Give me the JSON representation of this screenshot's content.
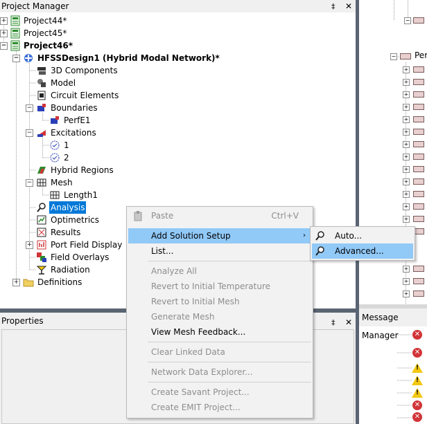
{
  "project_manager": {
    "title": "Project Manager",
    "pin": "‡",
    "close": "✕",
    "tree": [
      {
        "label": "Project44*",
        "bold": false
      },
      {
        "label": "Project45*",
        "bold": false
      },
      {
        "label": "Project46*",
        "bold": true
      },
      {
        "label": "HFSSDesign1 (Hybrid Modal Network)*",
        "bold": true
      },
      {
        "label": "3D Components"
      },
      {
        "label": "Model"
      },
      {
        "label": "Circuit Elements"
      },
      {
        "label": "Boundaries"
      },
      {
        "label": "PerfE1"
      },
      {
        "label": "Excitations"
      },
      {
        "label": "1"
      },
      {
        "label": "2"
      },
      {
        "label": "Hybrid Regions"
      },
      {
        "label": "Mesh"
      },
      {
        "label": "Length1"
      },
      {
        "label": "Analysis"
      },
      {
        "label": "Optimetrics"
      },
      {
        "label": "Results"
      },
      {
        "label": "Port Field Display"
      },
      {
        "label": "Field Overlays"
      },
      {
        "label": "Radiation"
      },
      {
        "label": "Definitions"
      }
    ]
  },
  "properties": {
    "title": "Properties",
    "pin": "‡",
    "close": "✕"
  },
  "message_manager": {
    "title": "Message Manager"
  },
  "right_tree": {
    "visible_label": "Per"
  },
  "context_menu": {
    "items": [
      {
        "label": "Paste",
        "shortcut": "Ctrl+V",
        "disabled": true
      },
      {
        "label": "Add Solution Setup",
        "submenu": true,
        "highlighted": true
      },
      {
        "label": "List..."
      },
      {
        "label": "Analyze All",
        "disabled": true
      },
      {
        "label": "Revert to Initial Temperature",
        "disabled": true
      },
      {
        "label": "Revert to Initial Mesh",
        "disabled": true
      },
      {
        "label": "Generate Mesh",
        "disabled": true
      },
      {
        "label": "View Mesh Feedback..."
      },
      {
        "label": "Clear Linked Data",
        "disabled": true
      },
      {
        "label": "Network Data Explorer...",
        "disabled": true
      },
      {
        "label": "Create Savant Project...",
        "disabled": true
      },
      {
        "label": "Create EMIT Project...",
        "disabled": true
      }
    ],
    "submenu_arrow": "›"
  },
  "submenu": {
    "items": [
      {
        "label": "Auto..."
      },
      {
        "label": "Advanced...",
        "highlighted": true
      }
    ]
  },
  "colors": {
    "selection": "#0078d7",
    "menu_highlight": "#91c9f7",
    "splitter": "#5a6473"
  }
}
